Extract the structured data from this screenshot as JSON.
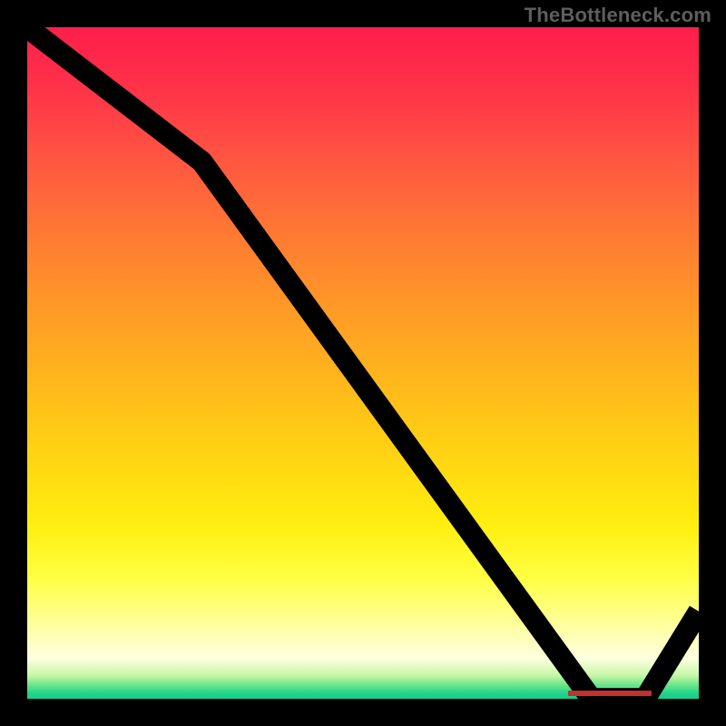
{
  "watermark": "TheBottleneck.com",
  "chart_data": {
    "type": "line",
    "title": "",
    "xlabel": "",
    "ylabel": "",
    "xlim": [
      0,
      100
    ],
    "ylim": [
      0,
      100
    ],
    "grid": false,
    "legend": false,
    "series": [
      {
        "name": "bottleneck-curve",
        "x": [
          0,
          26,
          84,
          92,
          100
        ],
        "values": [
          100,
          80,
          0,
          0,
          13
        ]
      }
    ],
    "annotations": [
      {
        "name": "optimal-range-bar",
        "x_start": 80.5,
        "x_end": 93,
        "y": 0.8
      }
    ],
    "background_gradient": {
      "stops": [
        {
          "pct": 0,
          "color": "#ff1e4b"
        },
        {
          "pct": 50,
          "color": "#ffbf1a"
        },
        {
          "pct": 85,
          "color": "#ffff70"
        },
        {
          "pct": 100,
          "color": "#14cf8e"
        }
      ]
    }
  }
}
